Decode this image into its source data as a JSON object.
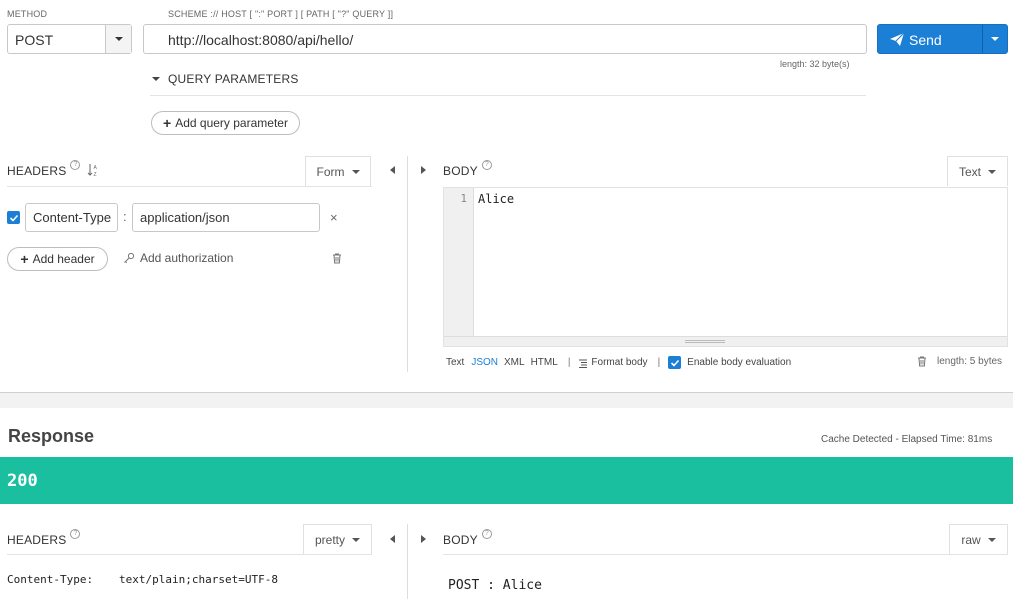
{
  "request": {
    "method_label": "METHOD",
    "method_value": "POST",
    "url_label": "SCHEME :// HOST [ \":\" PORT ] [ PATH [ \"?\" QUERY ]]",
    "url_value": "http://localhost:8080/api/hello/",
    "send_label": "Send",
    "url_length": "length: 32 byte(s)",
    "query_params_label": "QUERY PARAMETERS",
    "add_query_param_label": "Add query parameter",
    "headers": {
      "title": "HEADERS",
      "help": "?",
      "mode_label": "Form",
      "items": [
        {
          "enabled": true,
          "name": "Content-Type",
          "value": "application/json"
        }
      ],
      "add_header_label": "Add header",
      "add_authorization_label": "Add authorization"
    },
    "body": {
      "title": "BODY",
      "help": "?",
      "mode_label": "Text",
      "line_number": "1",
      "content": "Alice",
      "format_text": "Text",
      "format_json": "JSON",
      "format_xml": "XML",
      "format_html": "HTML",
      "sep": "|",
      "format_body_label": "Format body",
      "enable_eval_label": "Enable body evaluation",
      "length": "length: 5 bytes"
    }
  },
  "response": {
    "title": "Response",
    "cache_info": "Cache Detected - Elapsed Time: 81ms",
    "status_code": "200",
    "status_color": "#1abf9f",
    "headers": {
      "title": "HEADERS",
      "help": "?",
      "mode_label": "pretty",
      "items": [
        {
          "name": "Content-Type:",
          "value": "text/plain;charset=UTF-8"
        }
      ]
    },
    "body": {
      "title": "BODY",
      "help": "?",
      "mode_label": "raw",
      "content": "POST : Alice"
    }
  },
  "colors": {
    "accent": "#1a7fd5",
    "success": "#1abf9f"
  }
}
